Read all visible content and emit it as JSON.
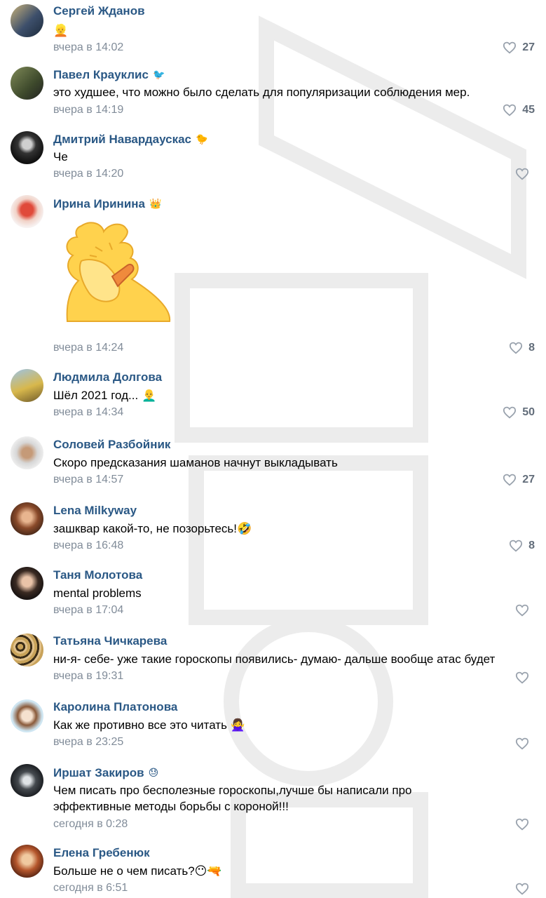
{
  "comments": [
    {
      "name": "Сергей Жданов",
      "badge": "",
      "text": "👱",
      "time": "вчера в 14:02",
      "likes": "27"
    },
    {
      "name": "Павел Крауклис",
      "badge": "🐦",
      "text": "это худшее, что можно было сделать для популяризации соблюдения мер.",
      "time": "вчера в 14:19",
      "likes": "45"
    },
    {
      "name": "Дмитрий Навардаускас",
      "badge": "🐤",
      "text": "Че",
      "time": "вчера в 14:20",
      "likes": ""
    },
    {
      "name": "Ирина Иринина",
      "badge": "👑",
      "text": "",
      "time": "вчера в 14:24",
      "likes": "8",
      "sticker": "facepalm-bird-sticker"
    },
    {
      "name": "Людмила Долгова",
      "badge": "",
      "text": "Шёл 2021 год... 👨‍🦲",
      "time": "вчера в 14:34",
      "likes": "50"
    },
    {
      "name": "Соловей Разбойник",
      "badge": "",
      "text": "Скоро предсказания шаманов начнут выкладывать",
      "time": "вчера в 14:57",
      "likes": "27"
    },
    {
      "name": "Lena Milkyway",
      "badge": "",
      "text": "зашквар какой-то, не позорьтесь!🤣",
      "time": "вчера в 16:48",
      "likes": "8"
    },
    {
      "name": "Таня Молотова",
      "badge": "",
      "text": "mental problems",
      "time": "вчера в 17:04",
      "likes": ""
    },
    {
      "name": "Татьяна Чичкарева",
      "badge": "",
      "text": "ни-я- себе- уже такие гороскопы появились- думаю- дальше вообще атас будет",
      "time": "вчера в 19:31",
      "likes": ""
    },
    {
      "name": "Каролина Платонова",
      "badge": "",
      "text": "Как же противно все это читать 🙅‍♀️",
      "time": "вчера в 23:25",
      "likes": ""
    },
    {
      "name": "Иршат Закиров",
      "badge": "😓",
      "text": "Чем писать про бесполезные гороскопы,лучше бы написали про эффективные методы борьбы с короной!!!",
      "time": "сегодня в 0:28",
      "likes": ""
    },
    {
      "name": "Елена Гребенюк",
      "badge": "",
      "text": "Больше не о чем писать?😶🔫",
      "time": "сегодня в 6:51",
      "likes": ""
    }
  ],
  "colors": {
    "name": "#2a5885",
    "time": "#818c99",
    "like_icon": "#99a2ad"
  }
}
